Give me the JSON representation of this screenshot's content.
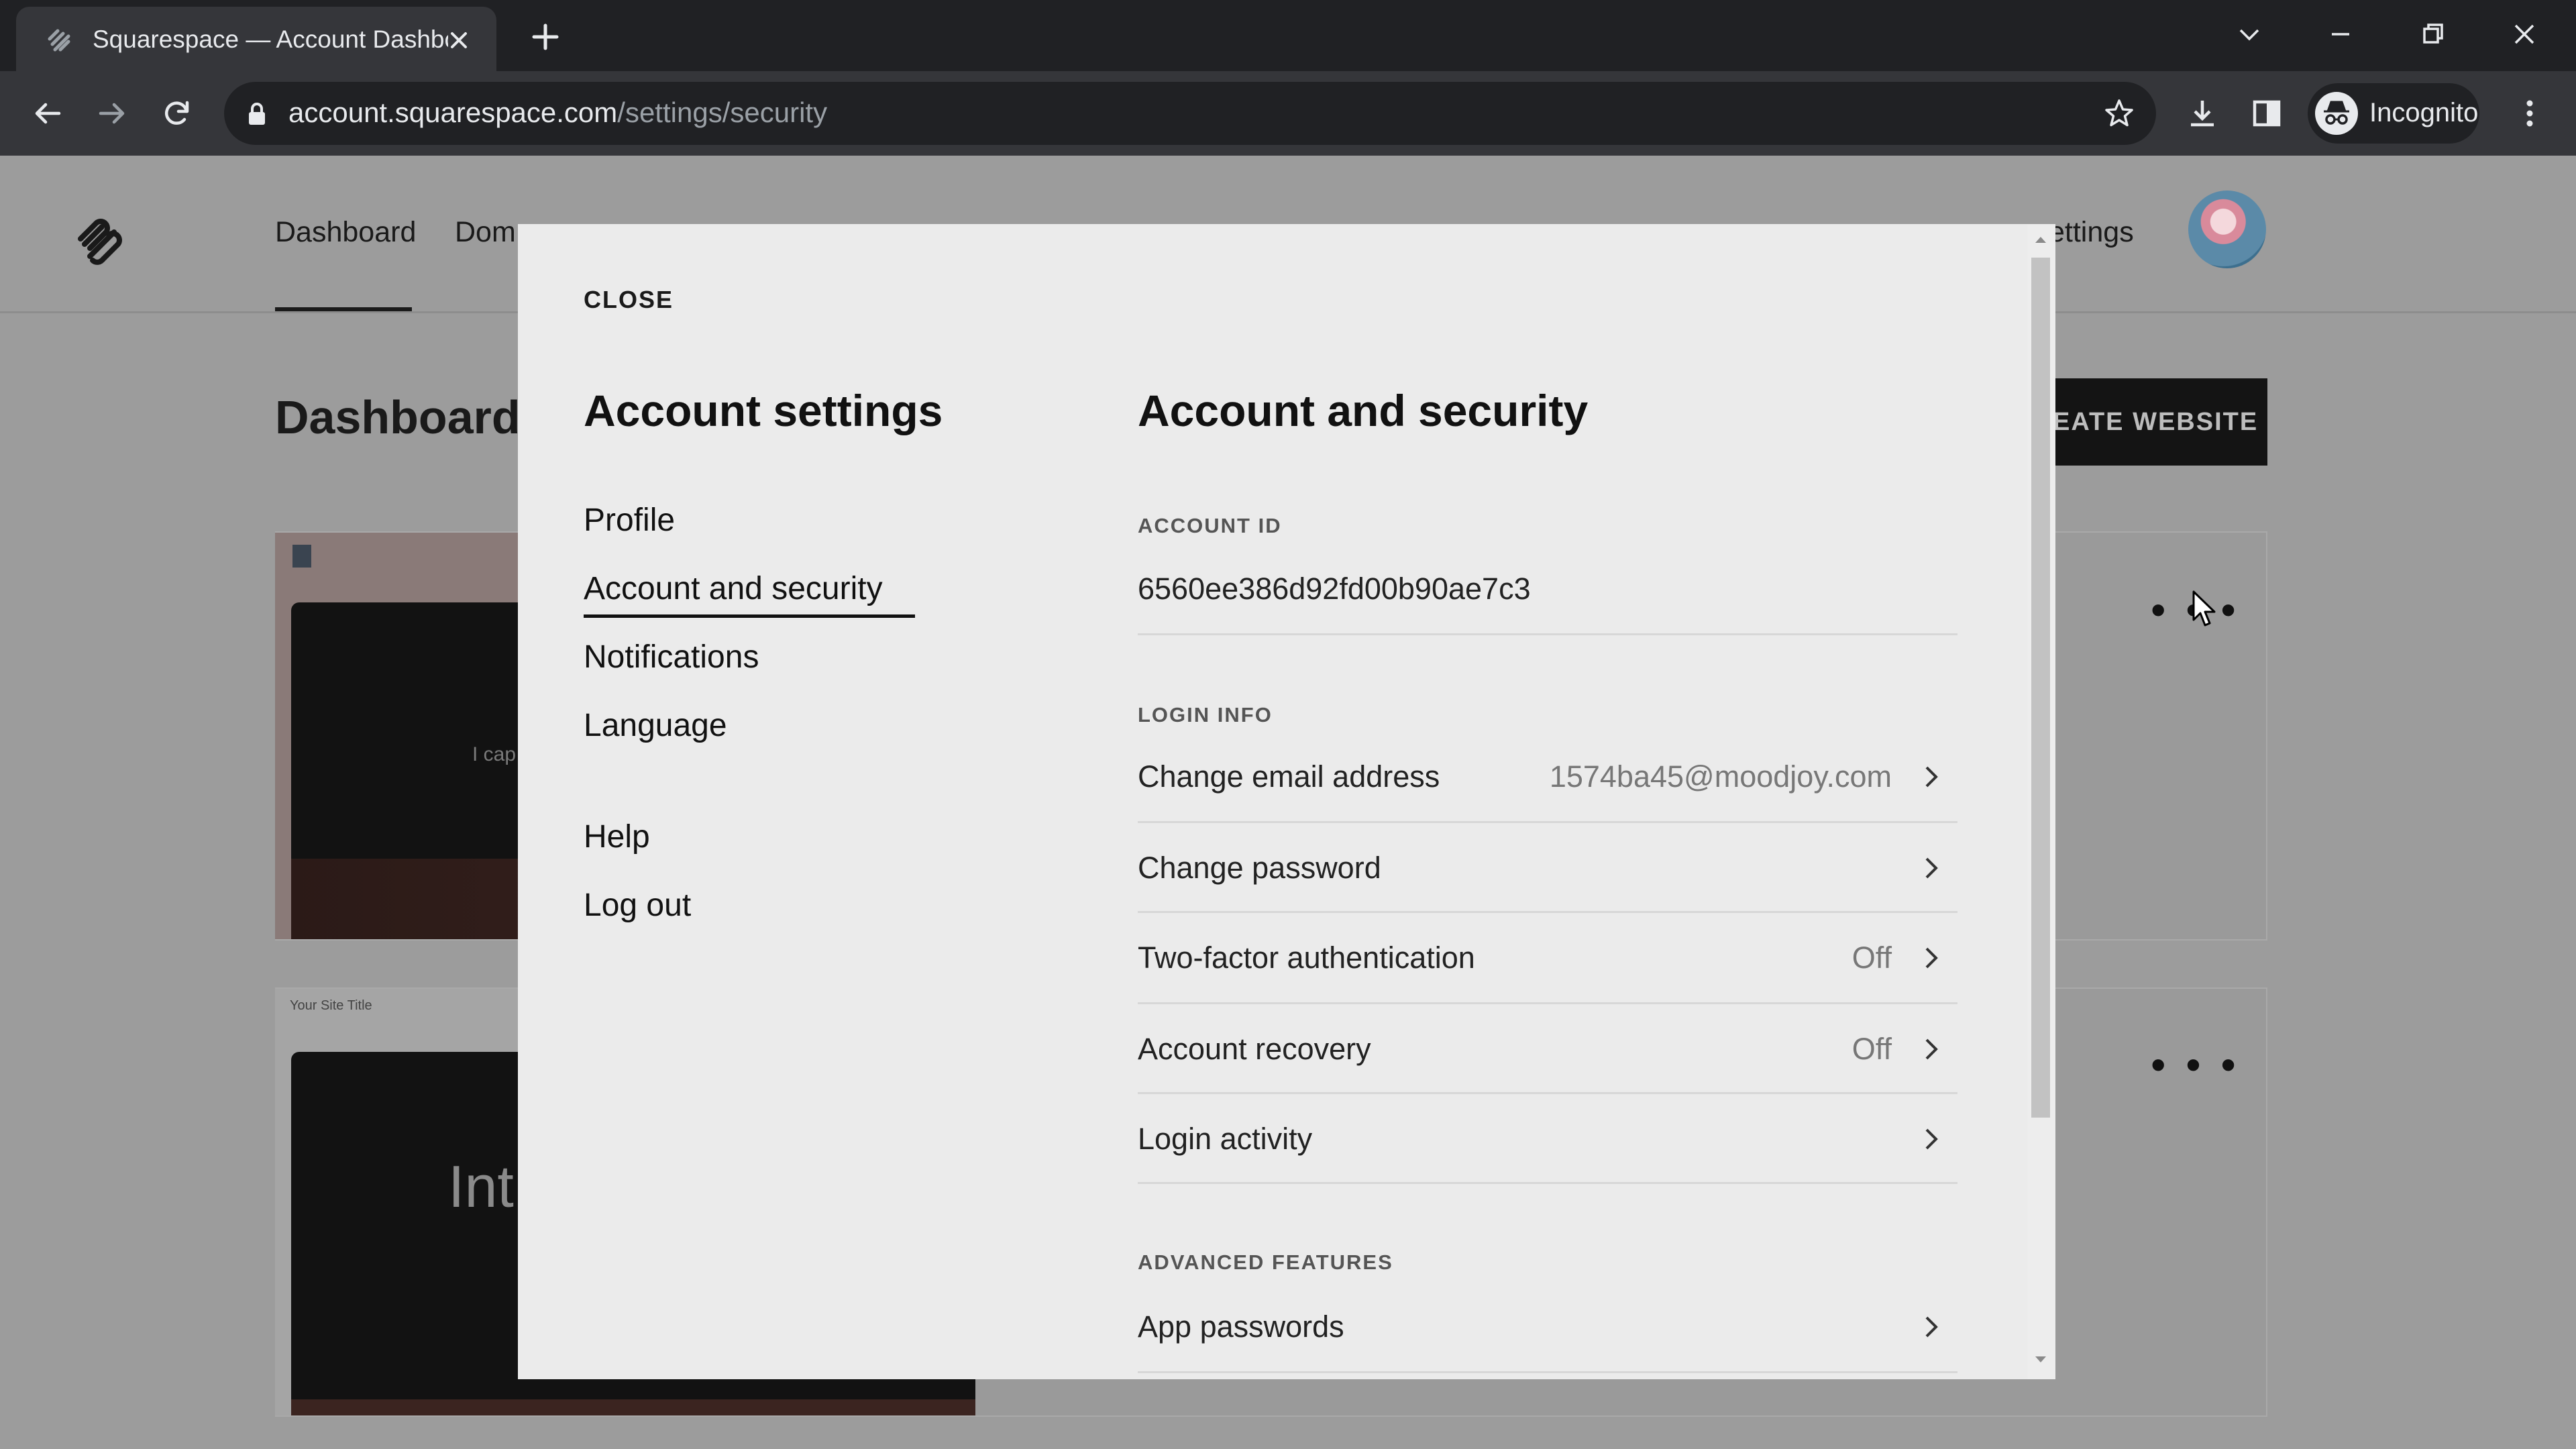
{
  "browser": {
    "tab_title": "Squarespace — Account Dashboard",
    "url_host": "account.squarespace.com",
    "url_path": "/settings/security",
    "profile_label": "Incognito"
  },
  "page": {
    "nav": {
      "dashboard": "Dashboard",
      "domains_partial": "Dom",
      "settings_partial": "ettings"
    },
    "title": "Dashboard",
    "create_button_partial": "EATE WEBSITE",
    "site1_thumb_text": "I cap",
    "site2_title": "Your Site Title",
    "site2_thumb_text": "Int",
    "more_menu_1": "• • •",
    "more_menu_2": "• • •"
  },
  "modal": {
    "close_label": "CLOSE",
    "settings_title": "Account settings",
    "menu": {
      "profile": "Profile",
      "account_security": "Account and security",
      "notifications": "Notifications",
      "language": "Language",
      "help": "Help",
      "logout": "Log out"
    },
    "section_title": "Account and security",
    "account_id_label": "ACCOUNT ID",
    "account_id": "6560ee386d92fd00b90ae7c3",
    "login_info_label": "LOGIN INFO",
    "rows": {
      "email": {
        "label": "Change email address",
        "value": "1574ba45@moodjoy.com"
      },
      "password": {
        "label": "Change password"
      },
      "two_factor": {
        "label": "Two-factor authentication",
        "value": "Off"
      },
      "recovery": {
        "label": "Account recovery",
        "value": "Off"
      },
      "activity": {
        "label": "Login activity"
      }
    },
    "advanced_label": "ADVANCED FEATURES",
    "app_passwords": {
      "label": "App passwords"
    }
  }
}
